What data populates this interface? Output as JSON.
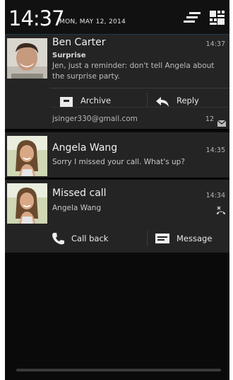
{
  "status": {
    "time": "14:37",
    "date": "MON, MAY 12, 2014"
  },
  "notifications": [
    {
      "sender": "Ben Carter",
      "time": "14:37",
      "subject": "Surprise",
      "body": "Jen, just a reminder: don't tell Angela about the surprise party.",
      "actions": [
        "Archive",
        "Reply"
      ],
      "account": "jsinger330@gmail.com",
      "count": "12"
    },
    {
      "sender": "Angela Wang",
      "time": "14:35",
      "body": "Sorry I missed your call. What's up?"
    },
    {
      "title": "Missed call",
      "time": "14:34",
      "caller": "Angela Wang",
      "actions": [
        "Call back",
        "Message"
      ]
    }
  ],
  "icons": {
    "header": [
      "clear-all-icon",
      "quick-settings-icon"
    ],
    "actions": [
      "archive-icon",
      "reply-icon",
      "phone-icon",
      "message-icon"
    ],
    "status": [
      "email-icon",
      "missed-call-icon"
    ]
  },
  "colors": {
    "background": "#0a0a0a",
    "card": "#242424",
    "accent": "#33b5e5",
    "text": "#f2f2f2"
  }
}
